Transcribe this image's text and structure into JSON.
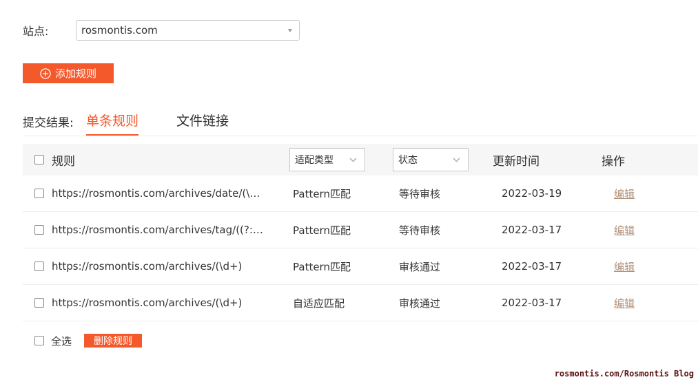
{
  "site": {
    "label": "站点:",
    "selected": "rosmontis.com"
  },
  "add_button": {
    "label": "添加规则"
  },
  "tabs": {
    "label": "提交结果:",
    "items": [
      {
        "label": "单条规则"
      },
      {
        "label": "文件链接"
      }
    ]
  },
  "table": {
    "headers": {
      "rule": "规则",
      "type_filter": "适配类型",
      "status_filter": "状态",
      "updated": "更新时间",
      "actions": "操作"
    },
    "rows": [
      {
        "rule": "https://rosmontis.com/archives/date/(\\w+...",
        "type": "Pattern匹配",
        "status": "等待审核",
        "date": "2022-03-19",
        "action": "编辑"
      },
      {
        "rule": "https://rosmontis.com/archives/tag/((?:%[...",
        "type": "Pattern匹配",
        "status": "等待审核",
        "date": "2022-03-17",
        "action": "编辑"
      },
      {
        "rule": "https://rosmontis.com/archives/(\\d+)",
        "type": "Pattern匹配",
        "status": "审核通过",
        "date": "2022-03-17",
        "action": "编辑"
      },
      {
        "rule": "https://rosmontis.com/archives/(\\d+)",
        "type": "自适应匹配",
        "status": "审核通过",
        "date": "2022-03-17",
        "action": "编辑"
      }
    ]
  },
  "footer": {
    "select_all": "全选",
    "delete_button": "删除规则"
  },
  "watermark": "rosmontis.com/Rosmontis Blog",
  "colors": {
    "accent": "#f4592c",
    "link": "#b09078",
    "header_bg": "#f6f6f6"
  }
}
